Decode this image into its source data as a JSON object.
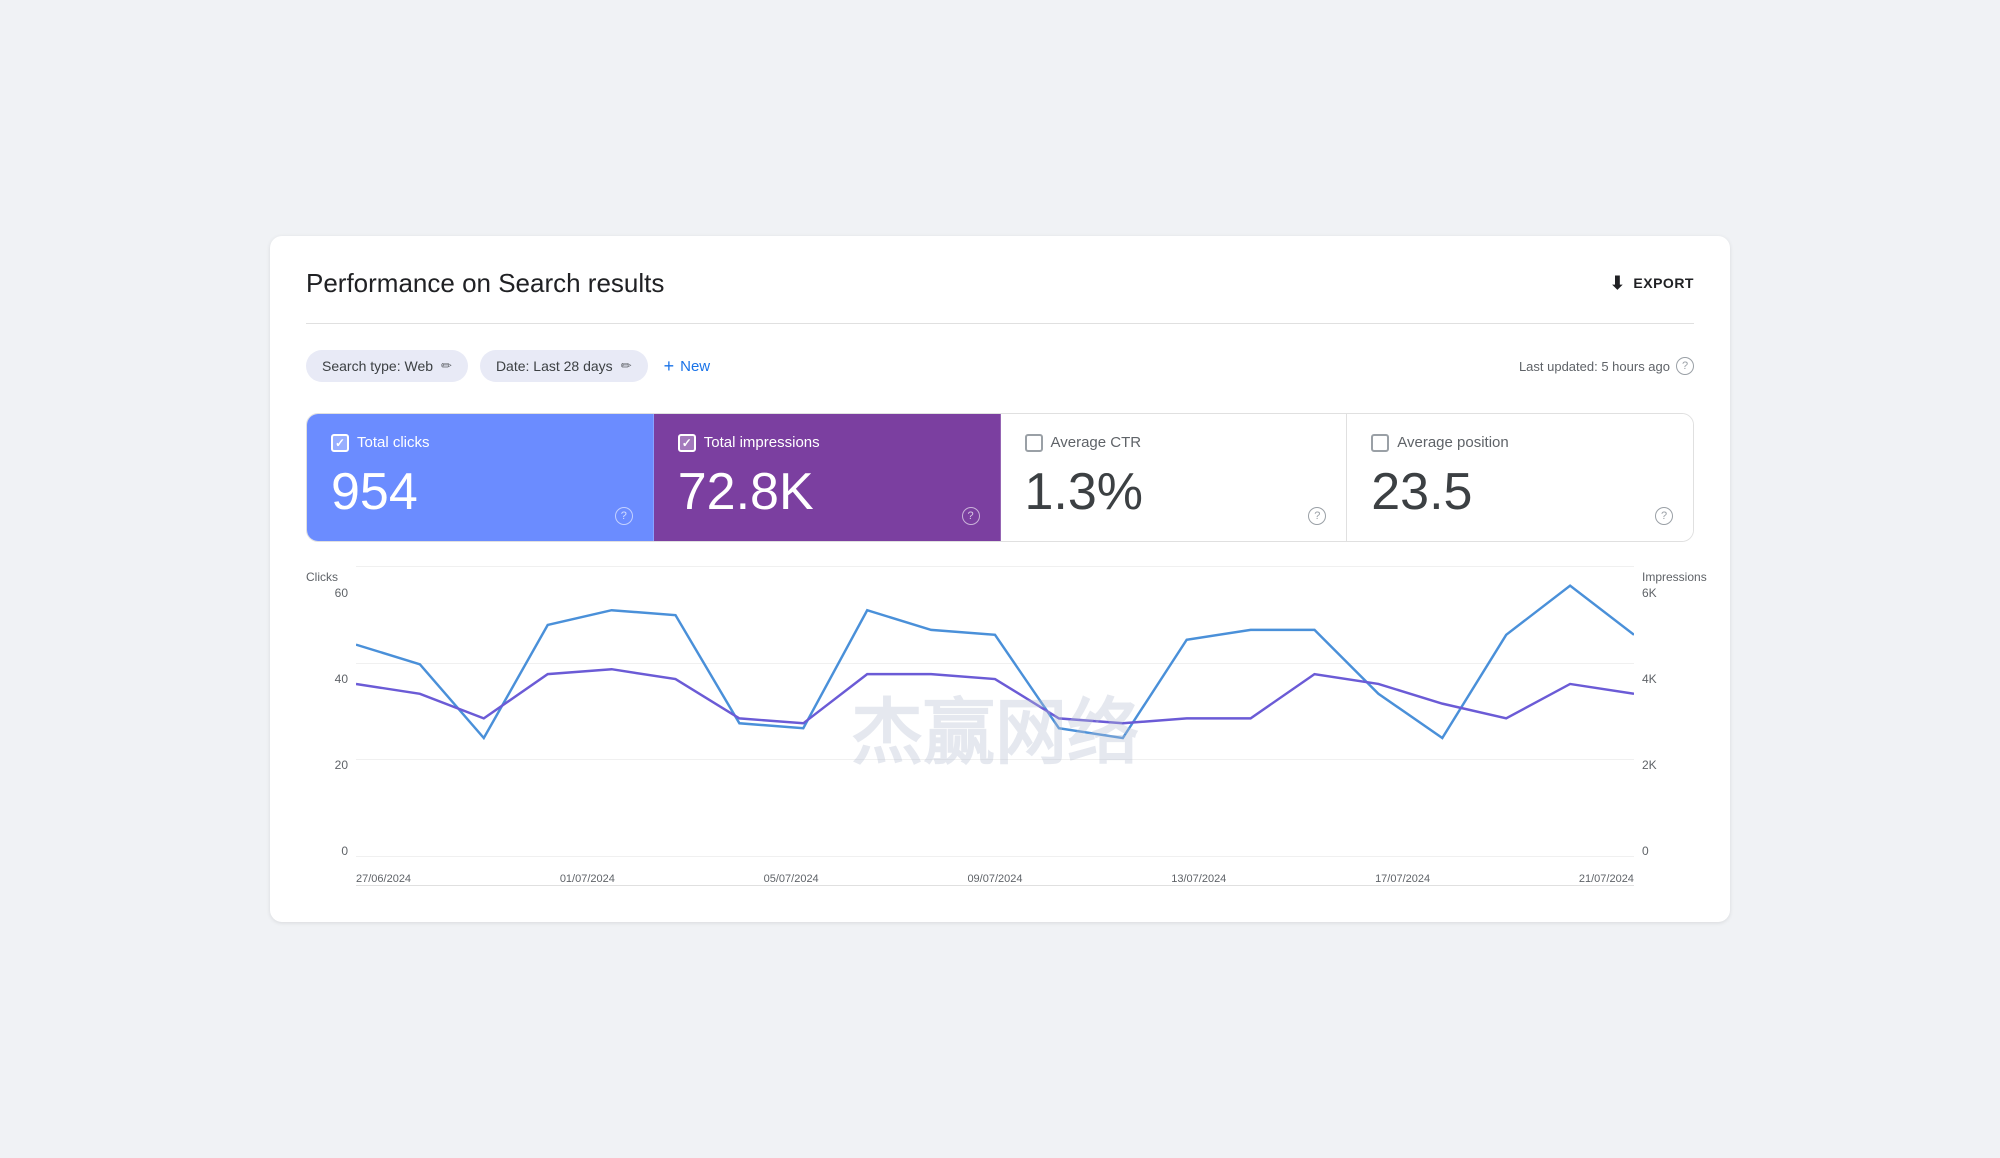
{
  "page": {
    "title": "Performance on Search results",
    "export_label": "EXPORT",
    "last_updated": "Last updated: 5 hours ago"
  },
  "filters": {
    "search_type": "Search type: Web",
    "date": "Date: Last 28 days",
    "new_button": "New"
  },
  "metrics": [
    {
      "id": "clicks",
      "label": "Total clicks",
      "value": "954",
      "checked": true,
      "theme": "light"
    },
    {
      "id": "impressions",
      "label": "Total impressions",
      "value": "72.8K",
      "checked": true,
      "theme": "light"
    },
    {
      "id": "ctr",
      "label": "Average CTR",
      "value": "1.3%",
      "checked": false,
      "theme": "dark"
    },
    {
      "id": "position",
      "label": "Average position",
      "value": "23.5",
      "checked": false,
      "theme": "dark"
    }
  ],
  "chart": {
    "y_axis_left_title": "Clicks",
    "y_axis_right_title": "Impressions",
    "y_labels_left": [
      "60",
      "40",
      "20",
      "0"
    ],
    "y_labels_right": [
      "6K",
      "4K",
      "2K",
      "0"
    ],
    "x_labels": [
      "27/06/2024",
      "01/07/2024",
      "05/07/2024",
      "09/07/2024",
      "13/07/2024",
      "17/07/2024",
      "21/07/2024"
    ],
    "watermark": "杰赢网络",
    "clicks_line_color": "#8c6fff",
    "impressions_line_color": "#4a90d9"
  }
}
